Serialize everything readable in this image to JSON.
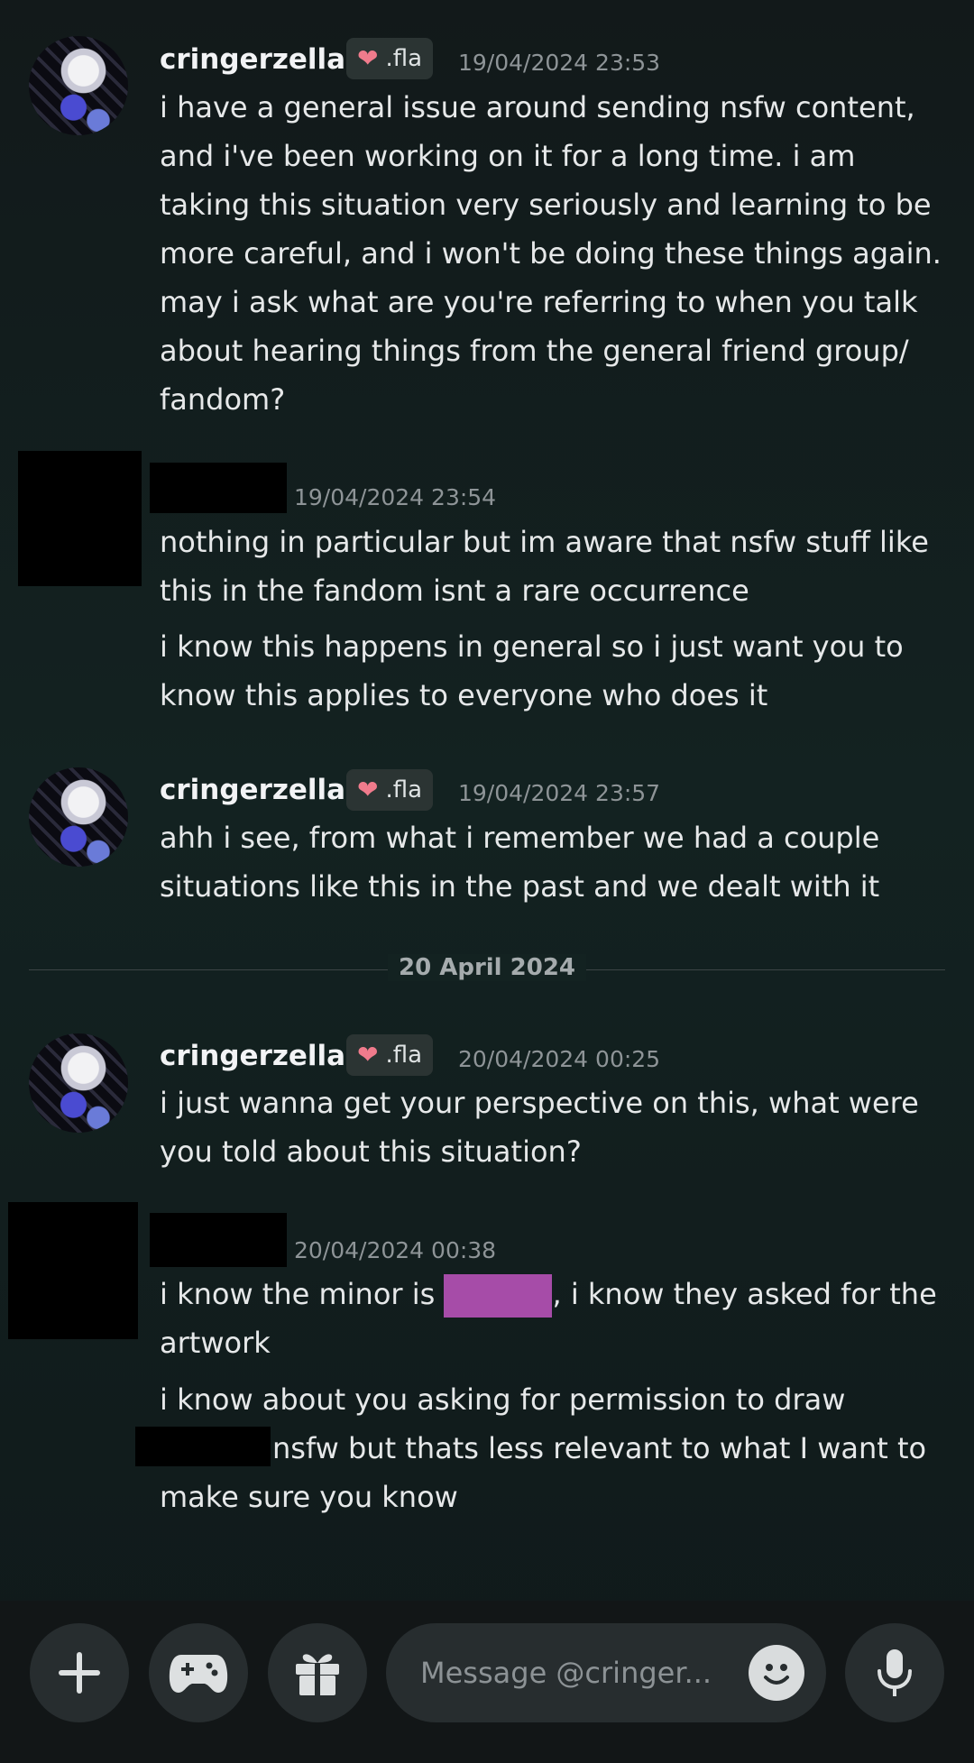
{
  "messages": [
    {
      "author": "cringerzella",
      "badge": ".fla",
      "timestamp": "19/04/2024 23:53",
      "paragraphs": [
        "i have a general issue around sending nsfw content, and i've been working on it for a long time. i am taking this situation very seriously and learning to be more careful, and i won't be doing these things again. may i ask what are you're referring to when you talk about hearing things from the general friend group/ fandom?"
      ]
    },
    {
      "author": "",
      "timestamp": "19/04/2024 23:54",
      "paragraphs": [
        "nothing in particular but im aware that nsfw stuff like this in the fandom isnt a rare occurrence",
        "i know this happens in general so i just want you to know this applies to everyone who does it"
      ]
    },
    {
      "author": "cringerzella",
      "badge": ".fla",
      "timestamp": "19/04/2024 23:57",
      "paragraphs": [
        "ahh i see, from what i remember we had a couple situations like this in the past and we dealt with it"
      ]
    },
    {
      "author": "cringerzella",
      "badge": ".fla",
      "timestamp": "20/04/2024 00:25",
      "paragraphs": [
        "i just wanna get your perspective on this, what were you told about this situation?"
      ]
    },
    {
      "author": "",
      "timestamp": "20/04/2024 00:38",
      "p1_before": "i know the minor is ",
      "p1_after": ", i know they asked for the artwork",
      "p2_before": "i know about you asking for permission to draw",
      "p2_after": "nsfw but thats less relevant to what I want to make sure you know"
    }
  ],
  "divider": "20 April 2024",
  "composer": {
    "placeholder": "Message @cringer..."
  }
}
